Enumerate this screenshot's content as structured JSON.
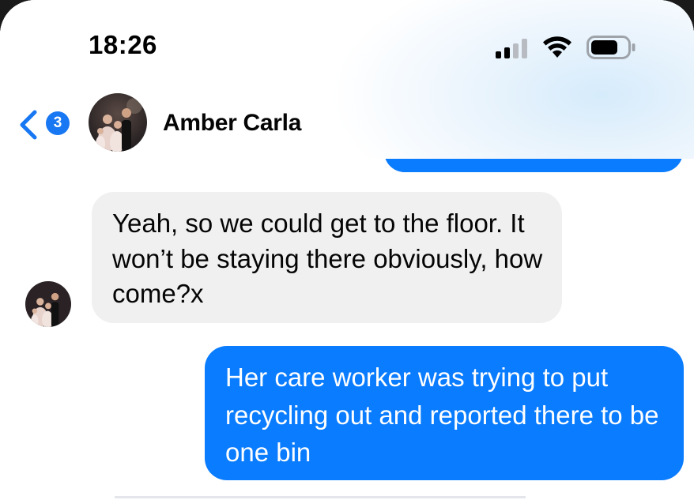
{
  "status_bar": {
    "time": "18:26"
  },
  "header": {
    "back_badge_count": "3",
    "contact_name": "Amber Carla"
  },
  "messages": [
    {
      "direction": "incoming",
      "text": "Yeah, so we could get to the floor. It won’t be staying there obviously, how come?x"
    },
    {
      "direction": "outgoing",
      "text": "Her care worker was trying to put recycling out and reported there to be one bin"
    }
  ],
  "colors": {
    "accent": "#1877f2",
    "outgoing_bubble": "#0a7cff",
    "incoming_bubble": "#f0f0f0"
  },
  "icons": {
    "signal": "cellular-signal-icon",
    "wifi": "wifi-icon",
    "battery": "battery-icon",
    "back": "chevron-left-icon"
  }
}
